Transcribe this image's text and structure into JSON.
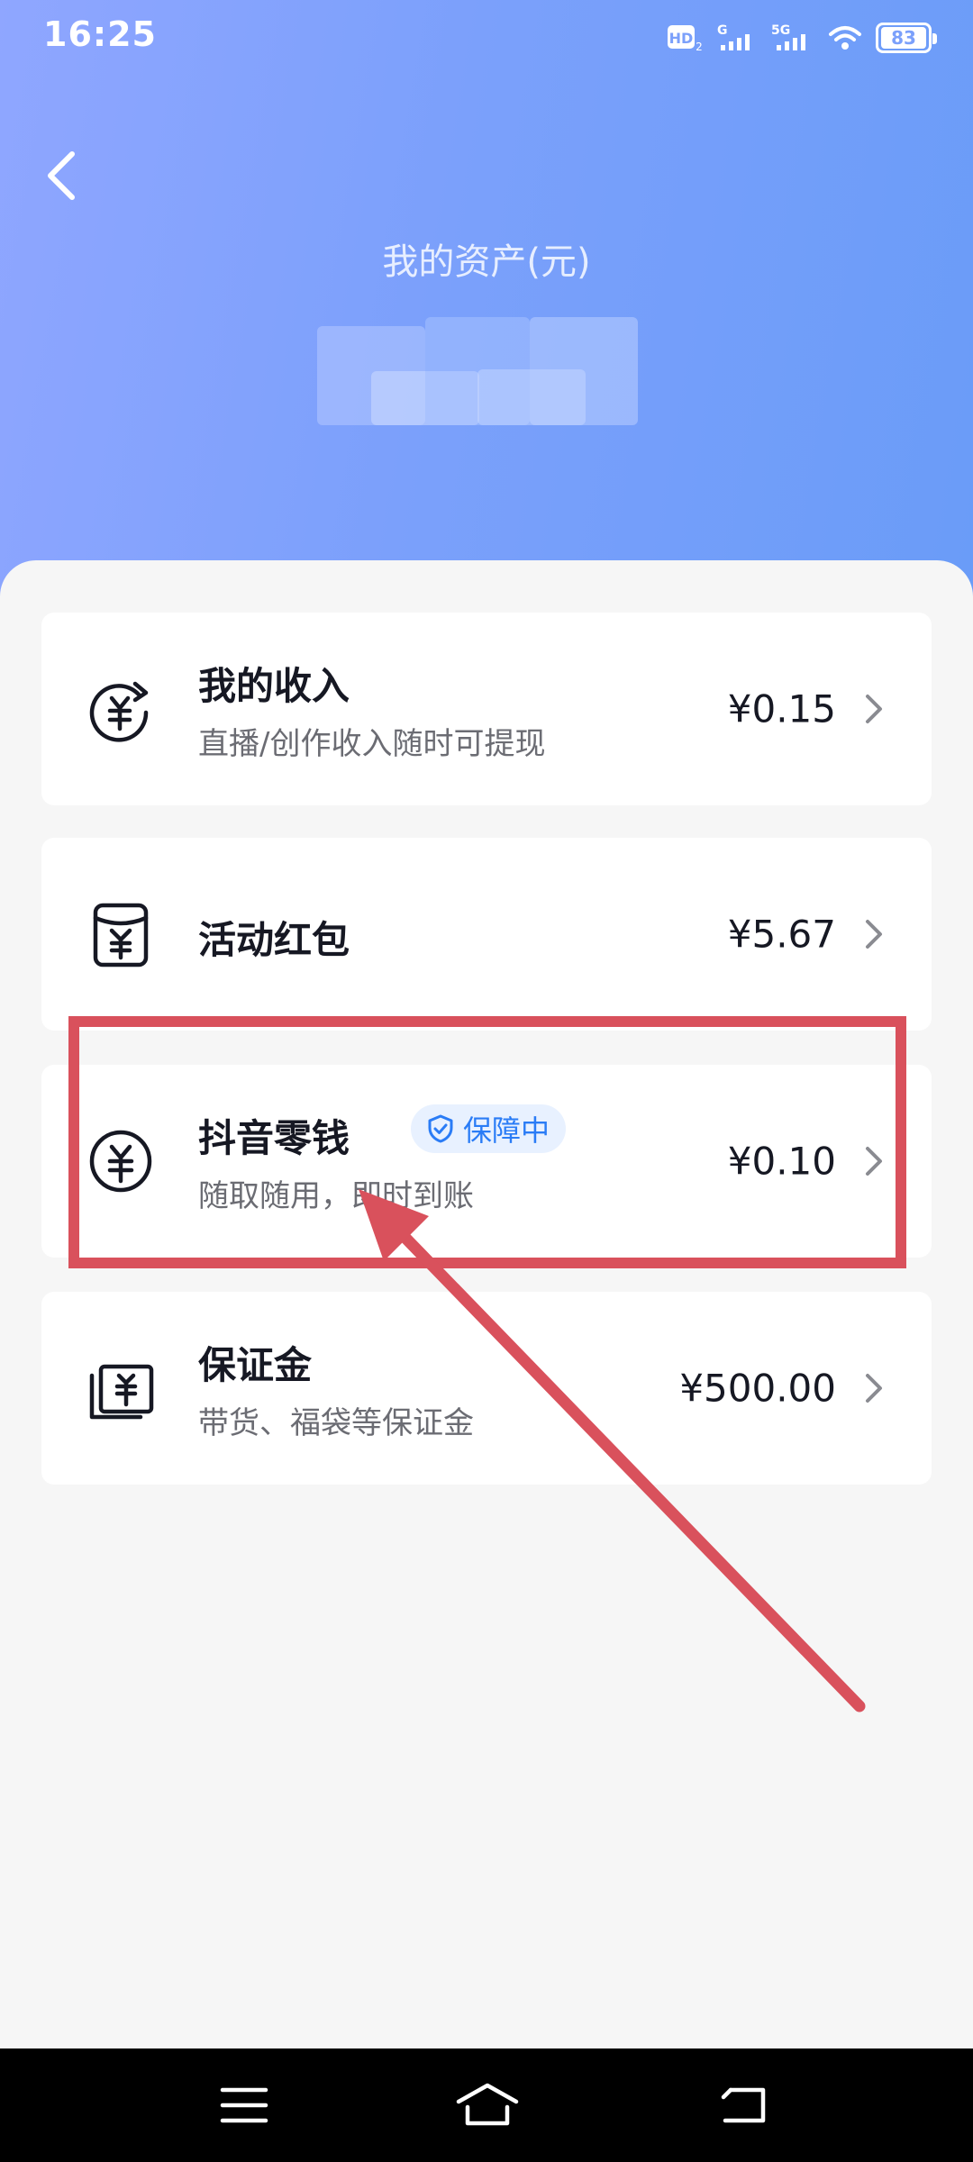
{
  "status_bar": {
    "time": "16:25",
    "battery": "83",
    "hd_label": "HD",
    "network_a": "G",
    "network_b": "5G"
  },
  "header": {
    "title": "我的资产(元)"
  },
  "cards": [
    {
      "icon": "yuan-exchange-icon",
      "title": "我的收入",
      "subtitle": "直播/创作收入随时可提现",
      "amount": "¥0.15"
    },
    {
      "icon": "red-packet-icon",
      "title": "活动红包",
      "amount": "¥5.67"
    },
    {
      "icon": "yuan-coin-icon",
      "title": "抖音零钱",
      "badge": "保障中",
      "subtitle": "随取随用，即时到账",
      "amount": "¥0.10"
    },
    {
      "icon": "deposit-icon",
      "title": "保证金",
      "subtitle": "带货、福袋等保证金",
      "amount": "¥500.00"
    }
  ],
  "colors": {
    "header_gradient_start": "#8fa6ff",
    "header_gradient_end": "#6a9cf8",
    "highlight": "#d9515c",
    "badge_text": "#2a7cf6",
    "badge_bg": "#e8f1ff"
  }
}
